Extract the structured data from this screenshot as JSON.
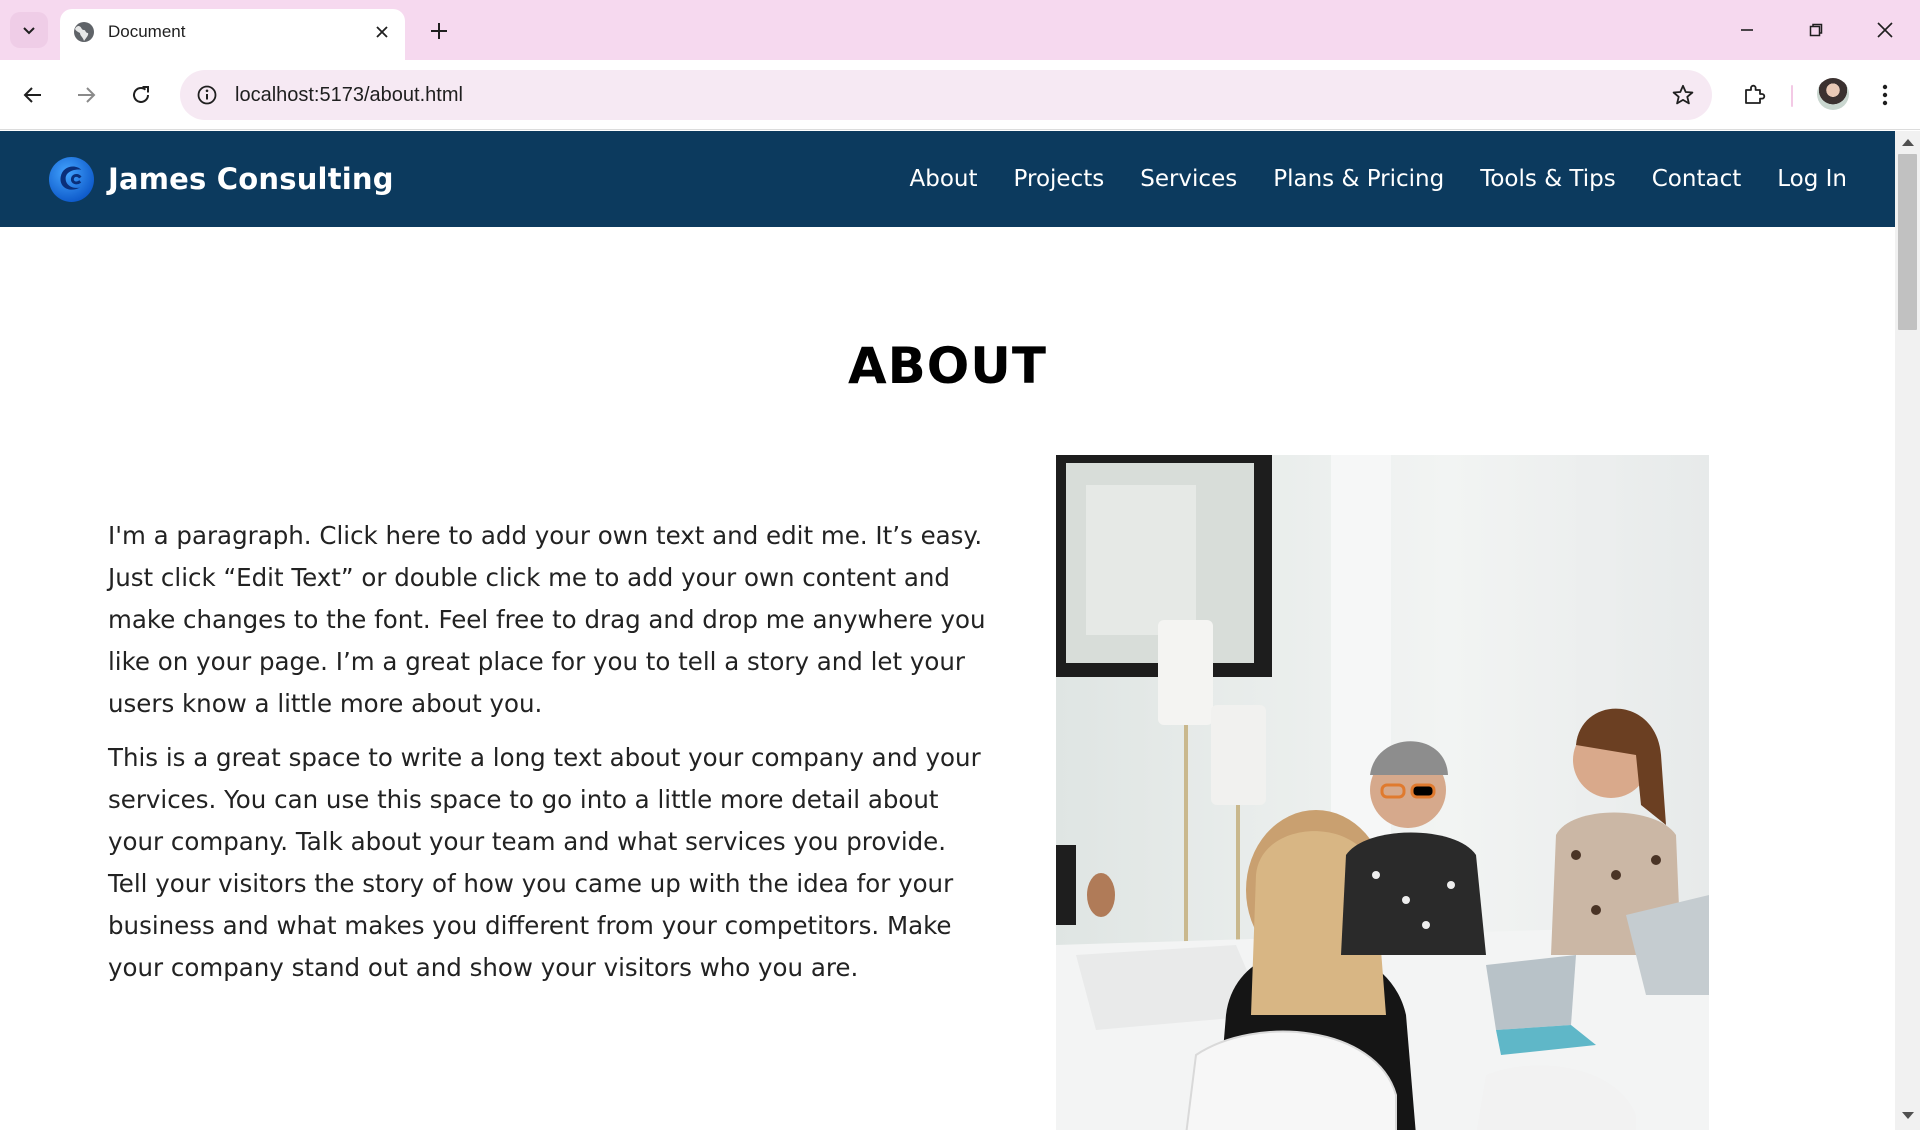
{
  "browser": {
    "tab_title": "Document",
    "url": "localhost:5173/about.html",
    "icons": [
      "tab-search-icon",
      "globe-icon",
      "close-icon",
      "plus-icon",
      "minimize-icon",
      "restore-icon",
      "close-window-icon",
      "back-arrow-icon",
      "forward-arrow-icon",
      "reload-icon",
      "site-info-icon",
      "star-icon",
      "extensions-icon",
      "more-vert-icon"
    ]
  },
  "site": {
    "brand": "James Consulting",
    "nav": [
      "About",
      "Projects",
      "Services",
      "Plans & Pricing",
      "Tools & Tips",
      "Contact",
      "Log In"
    ],
    "colors": {
      "header_bg": "#0c3a5e",
      "logo": "#1f7ae0"
    }
  },
  "main": {
    "title": "ABOUT",
    "paragraphs": [
      "I'm a paragraph. Click here to add your own text and edit me. It’s easy. Just click “Edit Text” or double click me to add your own content and make changes to the font. Feel free to drag and drop me anywhere you like on your page. I’m a great place for you to tell a story and let your users know a little more about you.",
      "This is a great space to write a long text about your company and your services. You can use this space to go into a little more detail about your company. Talk about your team and what services you provide. Tell your visitors the story of how you came up with the idea for your business and what makes you different from your competitors. Make your company stand out and show your visitors who you are."
    ]
  }
}
